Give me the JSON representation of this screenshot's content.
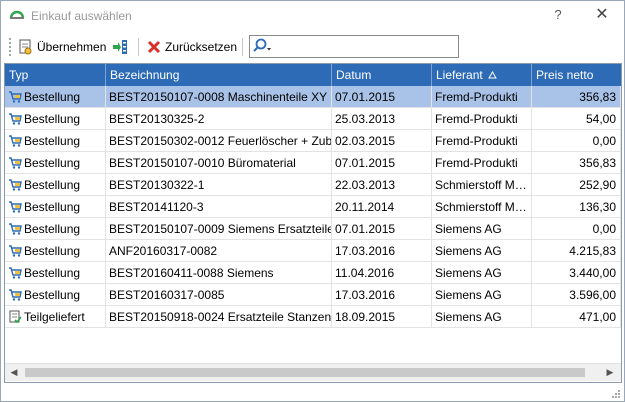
{
  "window": {
    "title": "Einkauf auswählen",
    "help_label": "?",
    "close_label": "✕"
  },
  "toolbar": {
    "uebernehmen_label": "Übernehmen",
    "zuruecksetzen_label": "Zurücksetzen",
    "search_value": ""
  },
  "colors": {
    "header_bg": "#2d6bb6",
    "selected_row": "#a8c2e8",
    "close_x": "#d9302b"
  },
  "table": {
    "columns": [
      "Typ",
      "Bezeichnung",
      "Datum",
      "Lieferant",
      "Preis netto"
    ],
    "sorted_column": "Lieferant",
    "rows": [
      [
        "Bestellung",
        "BEST20150107-0008 Maschinenteile XY",
        "07.01.2015",
        "Fremd-Produkti",
        "356,83"
      ],
      [
        "Bestellung",
        "BEST20130325-2",
        "25.03.2013",
        "Fremd-Produkti",
        "54,00"
      ],
      [
        "Bestellung",
        "BEST20150302-0012 Feuerlöscher + Zub…",
        "02.03.2015",
        "Fremd-Produkti",
        "0,00"
      ],
      [
        "Bestellung",
        "BEST20150107-0010 Büromaterial",
        "07.01.2015",
        "Fremd-Produkti",
        "356,83"
      ],
      [
        "Bestellung",
        "BEST20130322-1",
        "22.03.2013",
        "Schmierstoff M…",
        "252,90"
      ],
      [
        "Bestellung",
        "BEST20141120-3",
        "20.11.2014",
        "Schmierstoff M…",
        "136,30"
      ],
      [
        "Bestellung",
        "BEST20150107-0009 Siemens Ersatzteile",
        "07.01.2015",
        "Siemens AG",
        "0,00"
      ],
      [
        "Bestellung",
        "ANF20160317-0082",
        "17.03.2016",
        "Siemens AG",
        "4.215,83"
      ],
      [
        "Bestellung",
        "BEST20160411-0088 Siemens",
        "11.04.2016",
        "Siemens AG",
        "3.440,00"
      ],
      [
        "Bestellung",
        "BEST20160317-0085",
        "17.03.2016",
        "Siemens AG",
        "3.596,00"
      ],
      [
        "Teilgeliefert",
        "BEST20150918-0024 Ersatzteile Stanzen",
        "18.09.2015",
        "Siemens AG",
        "471,00"
      ]
    ],
    "selected_index": 0
  }
}
